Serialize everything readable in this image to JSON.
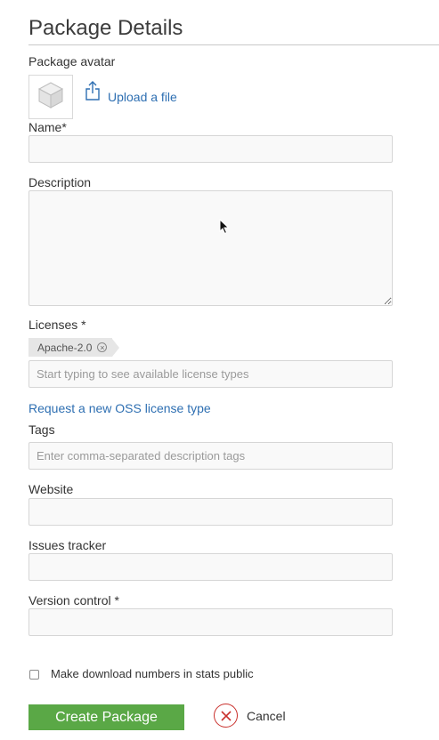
{
  "page": {
    "title": "Package Details"
  },
  "avatar": {
    "label": "Package avatar",
    "upload_label": "Upload a file"
  },
  "name": {
    "label": "Name*",
    "value": "",
    "placeholder": ""
  },
  "description": {
    "label": "Description",
    "value": "",
    "placeholder": ""
  },
  "licenses": {
    "label": "Licenses *",
    "selected": [
      "Apache-2.0"
    ],
    "placeholder": "Start typing to see available license types",
    "request_link": "Request a new OSS license type"
  },
  "tags": {
    "label": "Tags",
    "placeholder": "Enter comma-separated description tags",
    "value": ""
  },
  "website": {
    "label": "Website",
    "value": ""
  },
  "issues": {
    "label": "Issues tracker",
    "value": ""
  },
  "vcs": {
    "label": "Version control *",
    "value": ""
  },
  "stats": {
    "label": "Make download numbers in stats public",
    "checked": false
  },
  "actions": {
    "create_label": "Create Package",
    "cancel_label": "Cancel"
  },
  "colors": {
    "accent_link": "#2e6fb2",
    "create_button": "#5aa846",
    "cancel_icon": "#c9302c"
  }
}
